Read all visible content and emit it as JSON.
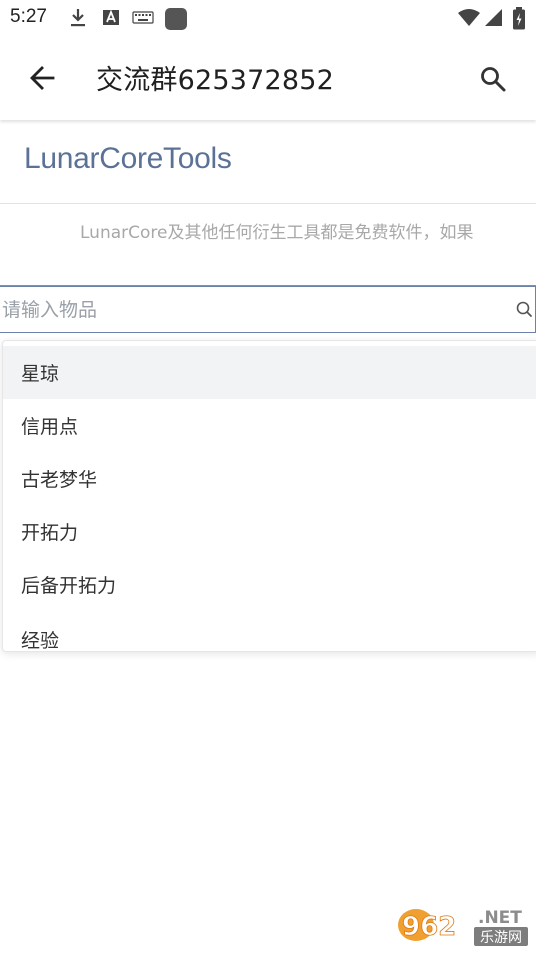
{
  "status_bar": {
    "time": "5:27"
  },
  "app_bar": {
    "title": "交流群625372852"
  },
  "brand": {
    "title": "LunarCoreTools"
  },
  "notice": {
    "text": "LunarCore及其他任何衍生工具都是免费软件，如果"
  },
  "search": {
    "placeholder": "请输入物品",
    "value": ""
  },
  "dropdown": {
    "items": [
      "星琼",
      "信用点",
      "古老梦华",
      "开拓力",
      "后备开拓力",
      "经验"
    ],
    "highlighted_index": 0
  },
  "watermark": {
    "brand": "962",
    "suffix": ".NET",
    "subtitle": "乐游网"
  },
  "colors": {
    "brand_text": "#5b7296",
    "outline": "#6d82a8",
    "highlight": "#f2f3f5"
  }
}
